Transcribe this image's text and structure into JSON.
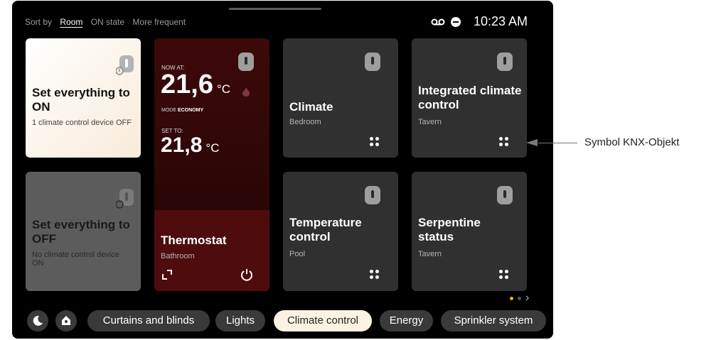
{
  "sort": {
    "label": "Sort by",
    "options": [
      "Room",
      "ON state",
      "More frequent"
    ],
    "selected": "Room"
  },
  "status": {
    "time": "10:23 AM",
    "icons": [
      "voicemail-icon",
      "do-not-disturb-icon"
    ]
  },
  "cards": {
    "all_on": {
      "title": "Set everything to ON",
      "sub": "1 climate control device OFF"
    },
    "all_off": {
      "title": "Set everything to OFF",
      "sub": "No climate control device ON"
    },
    "thermostat": {
      "now_label": "NOW AT:",
      "now_value": "21,6",
      "unit": "°C",
      "mode_label": "MODE",
      "mode_value": "ECONOMY",
      "set_label": "SET TO:",
      "set_value": "21,8",
      "title": "Thermostat",
      "room": "Bathroom"
    },
    "climate": {
      "title": "Climate",
      "room": "Bedroom"
    },
    "integrated": {
      "title": "Integrated climate control",
      "room": "Tavern"
    },
    "temperature": {
      "title": "Temperature control",
      "room": "Pool"
    },
    "serpentine": {
      "title": "Serpentine status",
      "room": "Tavern"
    }
  },
  "tabs": [
    "Curtains and blinds",
    "Lights",
    "Climate control",
    "Energy",
    "Sprinkler system"
  ],
  "selected_tab": "Climate control",
  "annotation": "Symbol KNX-Objekt",
  "colors": {
    "accent": "#f0a623",
    "thermostat_bg": "#3d0b0b",
    "selected_pill": "#fdf3e2"
  }
}
